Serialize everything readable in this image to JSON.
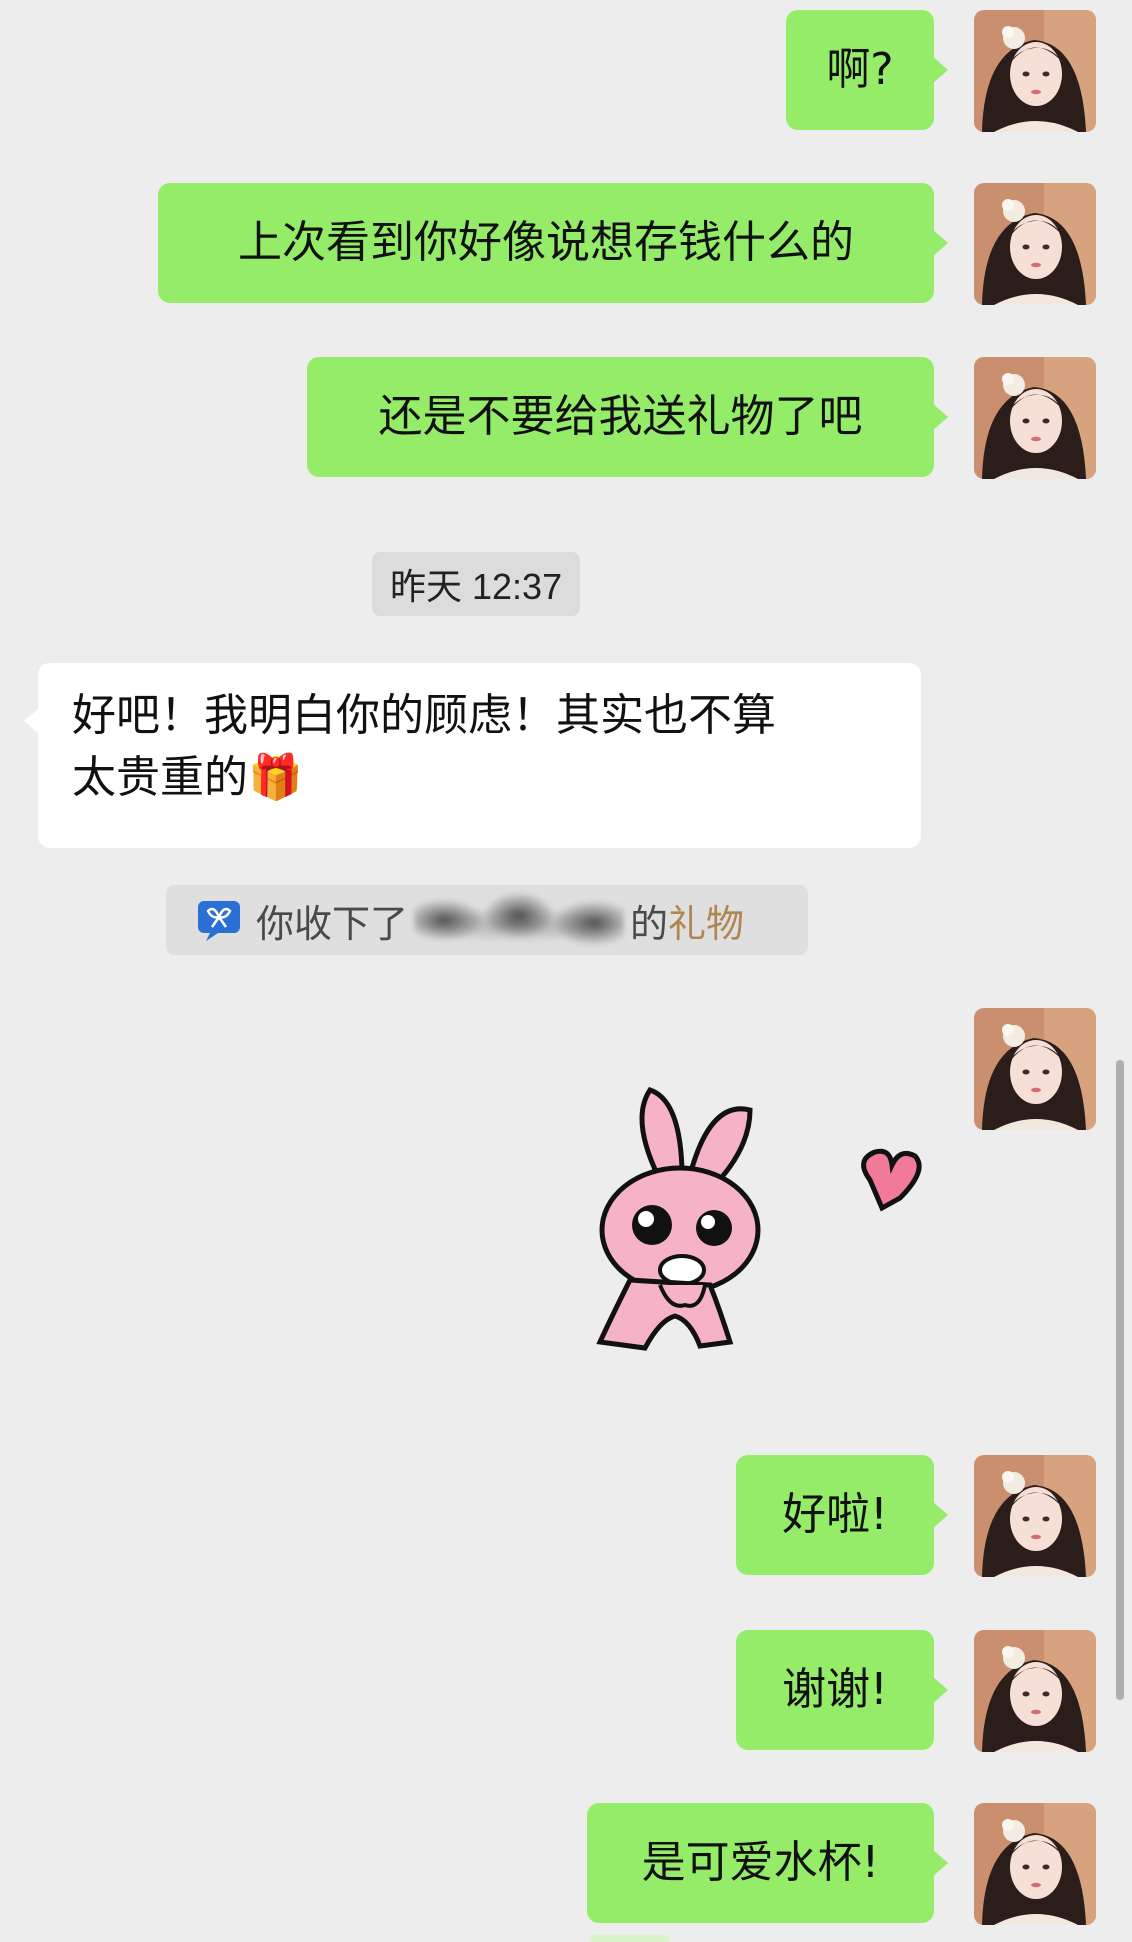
{
  "messages": [
    {
      "text": "啊?"
    },
    {
      "text": "上次看到你好像说想存钱什么的"
    },
    {
      "text": "还是不要给我送礼物了吧"
    }
  ],
  "timestamp": "昨天 12:37",
  "incoming": {
    "line1": "好吧！我明白你的顾虑！其实也不算",
    "line2": "太贵重的",
    "emoji": "🎁"
  },
  "gift_notice": {
    "prefix": "你收下了",
    "suffix": "的",
    "link": "礼物",
    "icon": "gift-ribbon-icon",
    "link_color": "#b18654"
  },
  "sticker": {
    "name": "pink-bunny-heart-sticker"
  },
  "messages_after": [
    {
      "text": "好啦!"
    },
    {
      "text": "谢谢!"
    },
    {
      "text": "是可爱水杯!"
    }
  ],
  "colors": {
    "background": "#ededed",
    "outgoing_bubble": "#95ec69",
    "incoming_bubble": "#ffffff"
  }
}
